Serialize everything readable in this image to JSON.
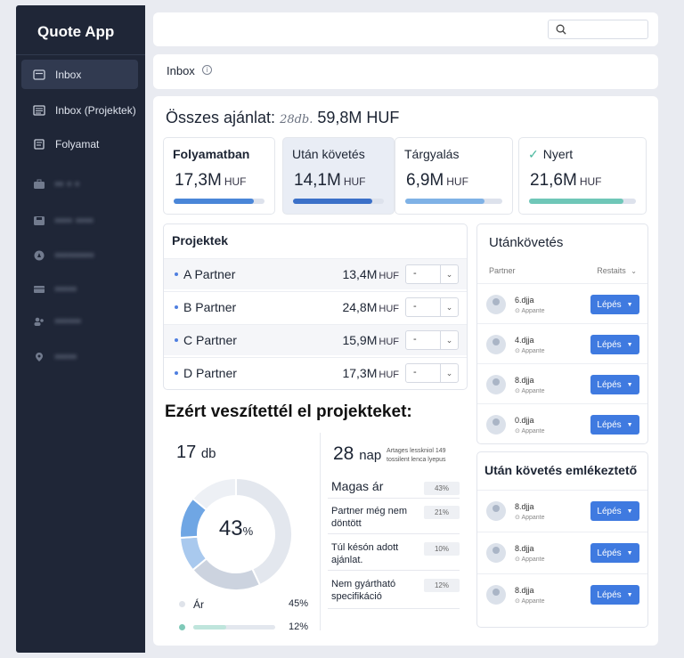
{
  "app": {
    "title": "Quote App"
  },
  "sidebar": {
    "items": [
      {
        "label": "Inbox",
        "icon": "inbox-icon",
        "active": true
      },
      {
        "label": "Inbox (Projektek)",
        "icon": "list-icon"
      },
      {
        "label": "Folyamat",
        "icon": "document-icon"
      },
      {
        "label": "▪▪ ▪ ▪",
        "icon": "briefcase-icon",
        "blurred": true
      },
      {
        "label": "▪▪▪▪ ▪▪▪▪",
        "icon": "save-icon",
        "blurred": true
      },
      {
        "label": "▪▪▪▪▪▪▪▪▪",
        "icon": "compass-icon",
        "blurred": true
      },
      {
        "label": "▪▪▪▪▪",
        "icon": "card-icon",
        "blurred": true
      },
      {
        "label": "▪▪▪▪▪▪",
        "icon": "users-icon",
        "blurred": true
      },
      {
        "label": "▪▪▪▪▪",
        "icon": "pin-icon",
        "blurred": true
      }
    ]
  },
  "search": {
    "placeholder": ""
  },
  "inbox": {
    "title": "Inbox"
  },
  "summary": {
    "label": "Összes ajánlat:",
    "count": "28db.",
    "total": "59,8M HUF"
  },
  "kpis": [
    {
      "label": "Folyamatban",
      "value": "17,3M",
      "unit": "HUF",
      "progress": 0.88,
      "color": "#4a86d8",
      "bg": "#ffffff"
    },
    {
      "label": "Után  követés",
      "value": "14,1M",
      "unit": "HUF",
      "progress": 0.87,
      "color": "#3b70c8",
      "bg": "#e9edf5"
    },
    {
      "label": "Tárgyalás",
      "value": "6,9M",
      "unit": "HUF",
      "progress": 0.82,
      "color": "#7fb2e6",
      "bg": "#ffffff"
    },
    {
      "label": "Nyert",
      "value": "21,6M",
      "unit": "HUF",
      "progress": 0.88,
      "color": "#6fc7b8",
      "bg": "#ffffff"
    }
  ],
  "projects": {
    "title": "Projektek",
    "rows": [
      {
        "name": "A Partner",
        "value": "13,4M",
        "unit": "HUF",
        "select": "-"
      },
      {
        "name": "B Partner",
        "value": "24,8M",
        "unit": "HUF",
        "select": "-"
      },
      {
        "name": "C  Partner",
        "value": "15,9M",
        "unit": "HUF",
        "select": "-"
      },
      {
        "name": "D Partner",
        "value": "17,3M",
        "unit": "HUF",
        "select": "-"
      }
    ]
  },
  "followup": {
    "title": "Utánkövetés",
    "col_partner": "Partner",
    "col_status": "Restaits",
    "rows": [
      {
        "name": "6.djja",
        "sub": "Appante",
        "button": "Lépés"
      },
      {
        "name": "4.djja",
        "sub": "Appante",
        "button": "Lépés"
      },
      {
        "name": "8.djja",
        "sub": "Appante",
        "button": "Lépés"
      },
      {
        "name": "0.djja",
        "sub": "Appante",
        "button": "Lépés"
      }
    ]
  },
  "reminder": {
    "title": "Után követés emlékeztető",
    "rows": [
      {
        "name": "8.djja",
        "sub": "Appante",
        "button": "Lépés"
      },
      {
        "name": "8.djja",
        "sub": "Appante",
        "button": "Lépés"
      },
      {
        "name": "8.djja",
        "sub": "Appante",
        "button": "Lépés"
      }
    ]
  },
  "lost": {
    "title": "Ezért veszítettél el projekteket:",
    "count": "17",
    "count_unit": "db",
    "days": "28",
    "days_unit": "nap",
    "days_note": "Artages lesskniol 149 tossilent lenca lyepus",
    "donut_center": "43",
    "donut_unit": "%",
    "legend": [
      {
        "label": "Ár",
        "value": "45%",
        "color": "#dfe3ea"
      },
      {
        "label": "",
        "value": "12%",
        "color": "#7fc9b8"
      }
    ],
    "reasons": [
      {
        "label": "Magas ár",
        "pct": "43%"
      },
      {
        "label": "Partner még nem döntött",
        "pct": "21%"
      },
      {
        "label": "Túl késón adott ajánlat.",
        "pct": "10%"
      },
      {
        "label": "Nem gyártható specifikáció",
        "pct": "12%"
      }
    ]
  },
  "chart_data": {
    "type": "pie",
    "values": [
      43,
      21,
      10,
      12,
      14
    ],
    "colors": [
      "#e3e7ee",
      "#ccd3df",
      "#a9c9ee",
      "#6fa6e4",
      "#edf0f5"
    ],
    "center_label": "43%"
  }
}
